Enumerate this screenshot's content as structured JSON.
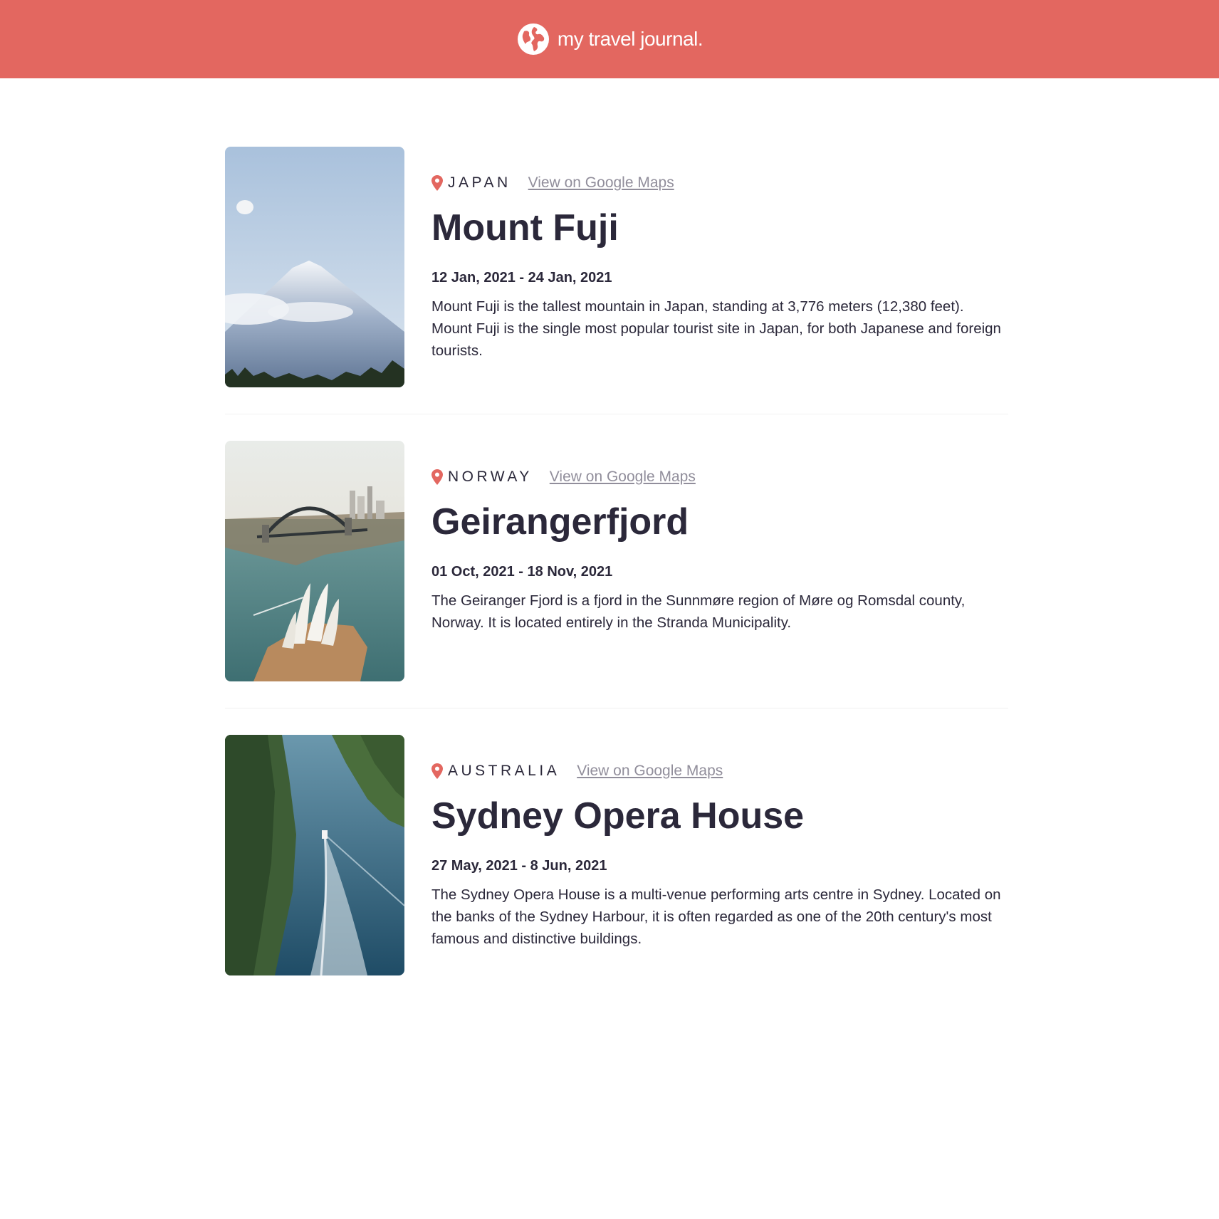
{
  "header": {
    "brand": "my travel journal.",
    "icon": "globe-icon",
    "color": "#e36760"
  },
  "entries": [
    {
      "country": "JAPAN",
      "map_link": "View on Google Maps",
      "title": "Mount Fuji",
      "dates": "12 Jan, 2021 - 24 Jan, 2021",
      "description": "Mount Fuji is the tallest mountain in Japan, standing at 3,776 meters (12,380 feet). Mount Fuji is the single most popular tourist site in Japan, for both Japanese and foreign tourists.",
      "image": "mount-fuji-photo"
    },
    {
      "country": "NORWAY",
      "map_link": "View on Google Maps",
      "title": "Geirangerfjord",
      "dates": "01 Oct, 2021 - 18 Nov, 2021",
      "description": "The Geiranger Fjord is a fjord in the Sunnmøre region of Møre og Romsdal county, Norway. It is located entirely in the Stranda Municipality.",
      "image": "sydney-harbour-photo"
    },
    {
      "country": "AUSTRALIA",
      "map_link": "View on Google Maps",
      "title": "Sydney Opera House",
      "dates": "27 May, 2021 - 8 Jun, 2021",
      "description": "The Sydney Opera House is a multi-venue performing arts centre in Sydney. Located on the banks of the Sydney Harbour, it is often regarded as one of the 20th century's most famous and distinctive buildings.",
      "image": "fjord-photo"
    }
  ],
  "colors": {
    "accent": "#e36760",
    "text": "#2b283a",
    "muted": "#918e9b"
  }
}
